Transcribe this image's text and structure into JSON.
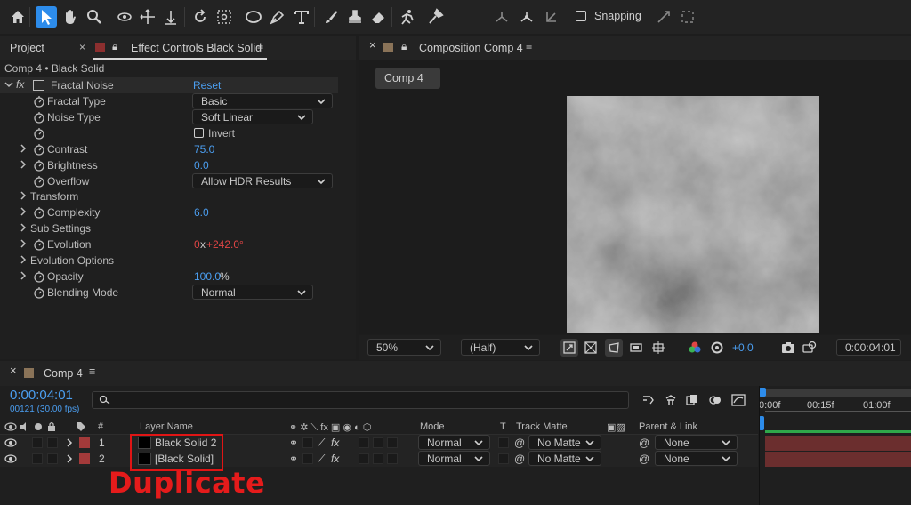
{
  "toolbar": {
    "tools": [
      "home-icon",
      "selection-icon",
      "hand-icon",
      "zoom-icon",
      "orbit-icon",
      "pan-icon",
      "dolly-icon",
      "rotate-icon",
      "anchor-icon",
      "ellipse-icon",
      "pen-icon",
      "type-icon",
      "brush-icon",
      "stamp-icon",
      "eraser-icon",
      "roto-icon",
      "puppet-icon"
    ],
    "snapping_label": "Snapping"
  },
  "left_panel": {
    "tab_project": "Project",
    "tab_effect": "Effect Controls Black Solid",
    "breadcrumb": "Comp 4 • Black Solid",
    "effect_name": "Fractal Noise",
    "reset_label": "Reset",
    "properties": [
      {
        "label": "Fractal Type",
        "dropdown": "Basic"
      },
      {
        "label": "Noise Type",
        "dropdown": "Soft Linear"
      },
      {
        "label": "",
        "checkbox_label": "Invert"
      },
      {
        "label": "Contrast",
        "value": "75.0"
      },
      {
        "label": "Brightness",
        "value": "0.0"
      },
      {
        "label": "Overflow",
        "dropdown": "Allow HDR Results"
      },
      {
        "label": "Transform"
      },
      {
        "label": "Complexity",
        "value": "6.0"
      },
      {
        "label": "Sub Settings"
      },
      {
        "label": "Evolution",
        "value_rev": "0",
        "value_x": "x",
        "value_deg": "+242.0°"
      },
      {
        "label": "Evolution Options"
      },
      {
        "label": "Opacity",
        "value": "100.0",
        "unit": "%"
      },
      {
        "label": "Blending Mode",
        "dropdown": "Normal"
      }
    ]
  },
  "comp_panel": {
    "tab_title": "Composition Comp 4",
    "comp_chip": "Comp 4",
    "zoom": "50%",
    "resolution": "(Half)",
    "exposure": "+0.0",
    "timecode": "0:00:04:01"
  },
  "timeline": {
    "tab_title": "Comp 4",
    "current_time": "0:00:04:01",
    "frame_info": "00121 (30.00 fps)",
    "search_placeholder": "",
    "col_hash": "#",
    "col_layer_name": "Layer Name",
    "col_mode": "Mode",
    "col_t": "T",
    "col_track_matte": "Track Matte",
    "col_parent": "Parent & Link",
    "ruler": [
      "0:00f",
      "00:15f",
      "01:00f"
    ],
    "layers": [
      {
        "num": "1",
        "name": "Black Solid 2",
        "mode": "Normal",
        "matte": "No Matte",
        "parent": "None"
      },
      {
        "num": "2",
        "name": "[Black Solid]",
        "mode": "Normal",
        "matte": "No Matte",
        "parent": "None"
      }
    ]
  },
  "annotation": {
    "text": "Duplicate"
  },
  "colors": {
    "accent": "#2d8ceb",
    "value_blue": "#4b9ef0",
    "value_red": "#e04545",
    "annotation_red": "#e51b1b",
    "layer_label": "#a33a3a"
  }
}
